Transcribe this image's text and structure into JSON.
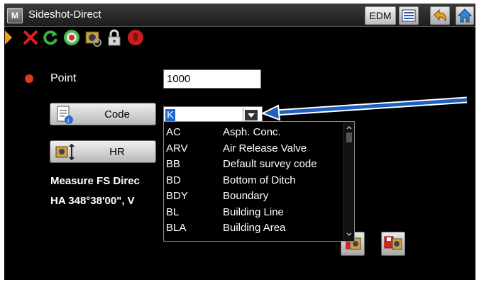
{
  "window": {
    "title": "Sideshot-Direct",
    "edm_label": "EDM"
  },
  "form": {
    "point_label": "Point",
    "point_value": "1000",
    "code_button_label": "Code",
    "code_value": "K",
    "hr_button_label": "HR",
    "measure_text": "Measure FS Direc",
    "ha_text": "HA 348°38'00\", V"
  },
  "dropdown": {
    "items": [
      {
        "code": "AC",
        "desc": "Asph. Conc."
      },
      {
        "code": "ARV",
        "desc": "Air Release Valve"
      },
      {
        "code": "BB",
        "desc": "Default survey code"
      },
      {
        "code": "BD",
        "desc": "Bottom of Ditch"
      },
      {
        "code": "BDY",
        "desc": "Boundary"
      },
      {
        "code": "BL",
        "desc": "Building Line"
      },
      {
        "code": "BLA",
        "desc": "Building Area"
      }
    ]
  },
  "colors": {
    "annotation_arrow": "#1f5fbf",
    "selection": "#1e66d0",
    "point_dot": "#e03a1e"
  },
  "icons": [
    "app-menu-icon",
    "list-icon",
    "back-arrow-icon",
    "home-icon",
    "play-icon",
    "stop-icon",
    "refresh-icon",
    "target-icon",
    "instrument-icon",
    "lock-icon",
    "record-icon",
    "code-doc-icon",
    "instrument-height-icon",
    "store-icon",
    "store-next-icon",
    "dropdown-arrow-icon"
  ]
}
